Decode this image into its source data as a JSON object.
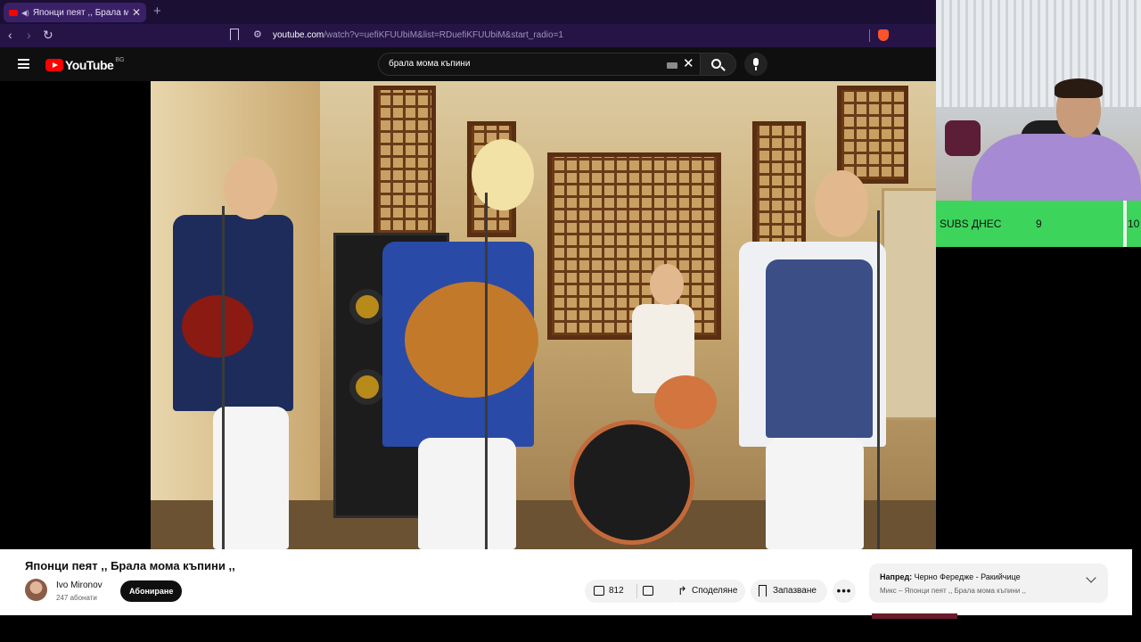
{
  "browser": {
    "tab_title": "Японци пеят ,, Брала мома к",
    "new_tab": "+",
    "url_host": "youtube.com",
    "url_rest": "/watch?v=uefiKFUUbiM&list=RDuefiKFUUbiM&start_radio=1"
  },
  "youtube": {
    "logo_text": "YouTube",
    "country_code": "BG",
    "search_value": "брала мома къпини"
  },
  "video": {
    "title": "Японци пеят ,, Брала мома къпини ,,",
    "channel_name": "Ivo Mironov",
    "subscribers": "247 абонати",
    "subscribe_label": "Абониране",
    "likes": "812",
    "share_label": "Споделяне",
    "save_label": "Запазване",
    "more_label": "•••"
  },
  "up_next": {
    "prefix": "Напред:",
    "title": "Черно Фередже - Ракийчице",
    "subtitle": "Микс – Японци пеят ,, Брала мома къпини ,,"
  },
  "overlay": {
    "subs_label": "SUBS ДНЕС",
    "subs_count": "9",
    "subs_goal": "10"
  },
  "colors": {
    "youtube_red": "#ff0000",
    "browser_purple": "#261447",
    "subs_green": "#3dd45c"
  }
}
